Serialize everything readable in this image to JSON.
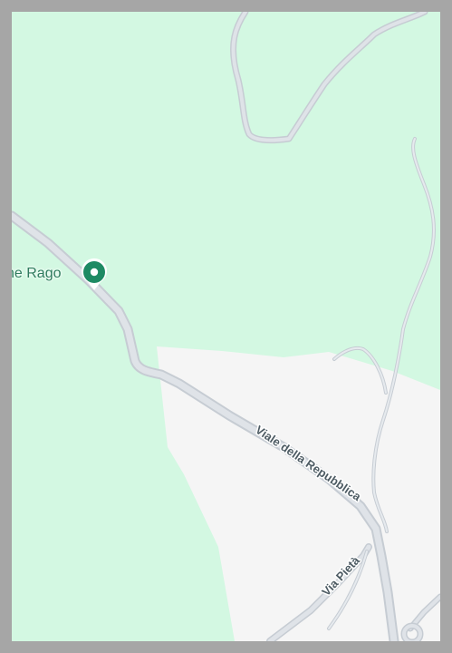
{
  "map": {
    "colors": {
      "park": "#d3f8e2",
      "urban": "#f5f5f5",
      "road_fill": "#dfe3e8",
      "road_casing": "#c6ccd3",
      "poi_marker": "#1e8a63",
      "border": "#a6a6a6"
    },
    "places": [
      {
        "label": "ne Rago",
        "icon": "park-pin-icon"
      }
    ],
    "roads": [
      {
        "name": "Viale della Repubblica"
      },
      {
        "name": "Via Pietà"
      }
    ]
  }
}
